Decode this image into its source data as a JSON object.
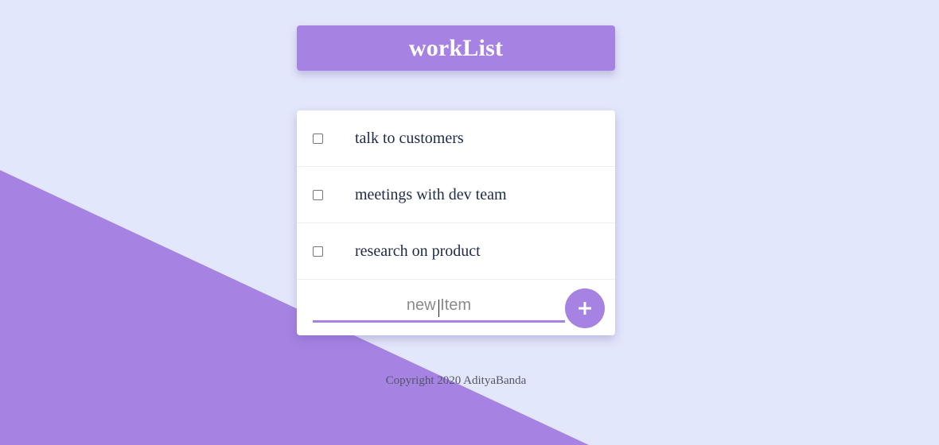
{
  "app": {
    "title": "workList"
  },
  "colors": {
    "background": "#e3e7fb",
    "accent": "#a683e3",
    "card": "#ffffff",
    "item_text": "#1f2a48"
  },
  "items": [
    {
      "label": "talk to customers",
      "checked": false
    },
    {
      "label": "meetings with dev team",
      "checked": false
    },
    {
      "label": "research on product",
      "checked": false
    }
  ],
  "new_item": {
    "placeholder": "new Item",
    "value": "",
    "add_icon": "plus-icon"
  },
  "footer": {
    "text": "Copyright 2020 AdityaBanda"
  }
}
